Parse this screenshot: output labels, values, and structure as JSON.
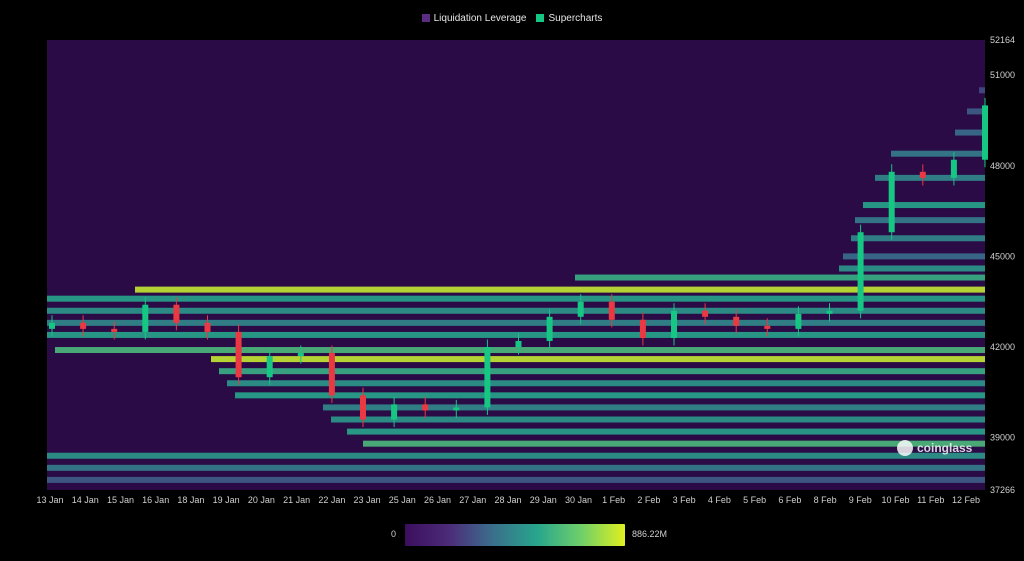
{
  "legend": {
    "items": [
      {
        "label": "Liquidation Leverage",
        "color": "#5a2d82"
      },
      {
        "label": "Supercharts",
        "color": "#16c784"
      }
    ]
  },
  "colorbar": {
    "min_label": "0",
    "max_label": "886.22M",
    "colors": [
      "#3b0f5e",
      "#4c2b79",
      "#3a6f8c",
      "#27a58c",
      "#6fcf6a",
      "#dff01f"
    ]
  },
  "watermark": {
    "text": "coinglass",
    "icon": "coinglass-logo-icon"
  },
  "chart_data": {
    "type": "heatmap",
    "title": "",
    "x_ticks": [
      "13 Jan",
      "14 Jan",
      "15 Jan",
      "16 Jan",
      "18 Jan",
      "19 Jan",
      "20 Jan",
      "21 Jan",
      "22 Jan",
      "23 Jan",
      "25 Jan",
      "26 Jan",
      "27 Jan",
      "28 Jan",
      "29 Jan",
      "30 Jan",
      "1 Feb",
      "2 Feb",
      "3 Feb",
      "4 Feb",
      "5 Feb",
      "6 Feb",
      "8 Feb",
      "9 Feb",
      "10 Feb",
      "11 Feb",
      "12 Feb"
    ],
    "y_ticks": [
      37266,
      39000,
      42000,
      45000,
      48000,
      51000,
      52164
    ],
    "ylim": [
      37266,
      52164
    ],
    "colorscale_range": [
      0,
      886.22
    ],
    "colorscale_unit": "M",
    "candles": {
      "dates": [
        "13 Jan",
        "14 Jan",
        "15 Jan",
        "16 Jan",
        "17 Jan",
        "18 Jan",
        "19 Jan",
        "20 Jan",
        "21 Jan",
        "22 Jan",
        "23 Jan",
        "24 Jan",
        "25 Jan",
        "26 Jan",
        "27 Jan",
        "28 Jan",
        "29 Jan",
        "30 Jan",
        "31 Jan",
        "1 Feb",
        "2 Feb",
        "3 Feb",
        "4 Feb",
        "5 Feb",
        "6 Feb",
        "7 Feb",
        "8 Feb",
        "9 Feb",
        "10 Feb",
        "11 Feb",
        "12 Feb"
      ],
      "close": [
        42800,
        42600,
        42500,
        43400,
        42800,
        42500,
        41000,
        41700,
        41800,
        40400,
        39600,
        40100,
        39900,
        40000,
        42000,
        42200,
        43000,
        43500,
        42900,
        42300,
        43200,
        43000,
        42700,
        42600,
        43100,
        43200,
        45800,
        47800,
        47600,
        48200,
        50000
      ]
    },
    "liquidation_bands": [
      {
        "price": 50500,
        "intensity": 0.3
      },
      {
        "price": 49800,
        "intensity": 0.35
      },
      {
        "price": 49100,
        "intensity": 0.4
      },
      {
        "price": 48400,
        "intensity": 0.45
      },
      {
        "price": 47600,
        "intensity": 0.5
      },
      {
        "price": 46700,
        "intensity": 0.6
      },
      {
        "price": 46200,
        "intensity": 0.45
      },
      {
        "price": 45600,
        "intensity": 0.5
      },
      {
        "price": 45000,
        "intensity": 0.4
      },
      {
        "price": 44600,
        "intensity": 0.55
      },
      {
        "price": 44300,
        "intensity": 0.65
      },
      {
        "price": 43900,
        "intensity": 0.95
      },
      {
        "price": 43600,
        "intensity": 0.6
      },
      {
        "price": 43200,
        "intensity": 0.55
      },
      {
        "price": 42800,
        "intensity": 0.5
      },
      {
        "price": 42400,
        "intensity": 0.6
      },
      {
        "price": 41900,
        "intensity": 0.7
      },
      {
        "price": 41600,
        "intensity": 0.95
      },
      {
        "price": 41200,
        "intensity": 0.65
      },
      {
        "price": 40800,
        "intensity": 0.55
      },
      {
        "price": 40400,
        "intensity": 0.6
      },
      {
        "price": 40000,
        "intensity": 0.5
      },
      {
        "price": 39600,
        "intensity": 0.55
      },
      {
        "price": 39200,
        "intensity": 0.6
      },
      {
        "price": 38800,
        "intensity": 0.7
      },
      {
        "price": 38400,
        "intensity": 0.55
      },
      {
        "price": 38000,
        "intensity": 0.45
      },
      {
        "price": 37600,
        "intensity": 0.35
      }
    ]
  }
}
